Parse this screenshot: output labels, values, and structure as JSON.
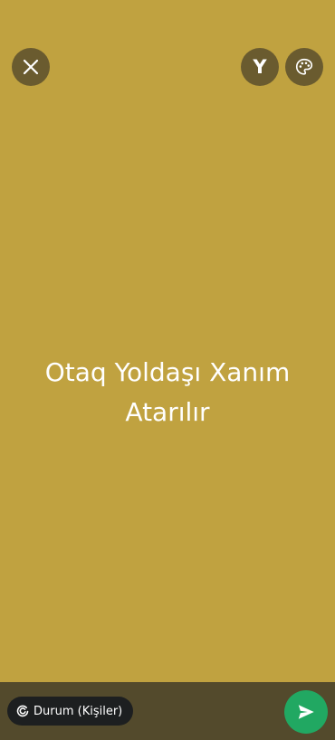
{
  "toolbar": {
    "close_icon": "close-icon",
    "font_button_letter": "Y",
    "palette_icon": "palette-icon"
  },
  "status": {
    "text": "Otaq Yoldaşı Xanım Atarılır",
    "background_color": "#C0A240",
    "text_color": "#FFFFFF"
  },
  "footer": {
    "audience_label": "Durum (Kişiler)",
    "audience_icon": "status-ring-icon",
    "send_icon": "send-icon",
    "send_color": "#21A862"
  }
}
